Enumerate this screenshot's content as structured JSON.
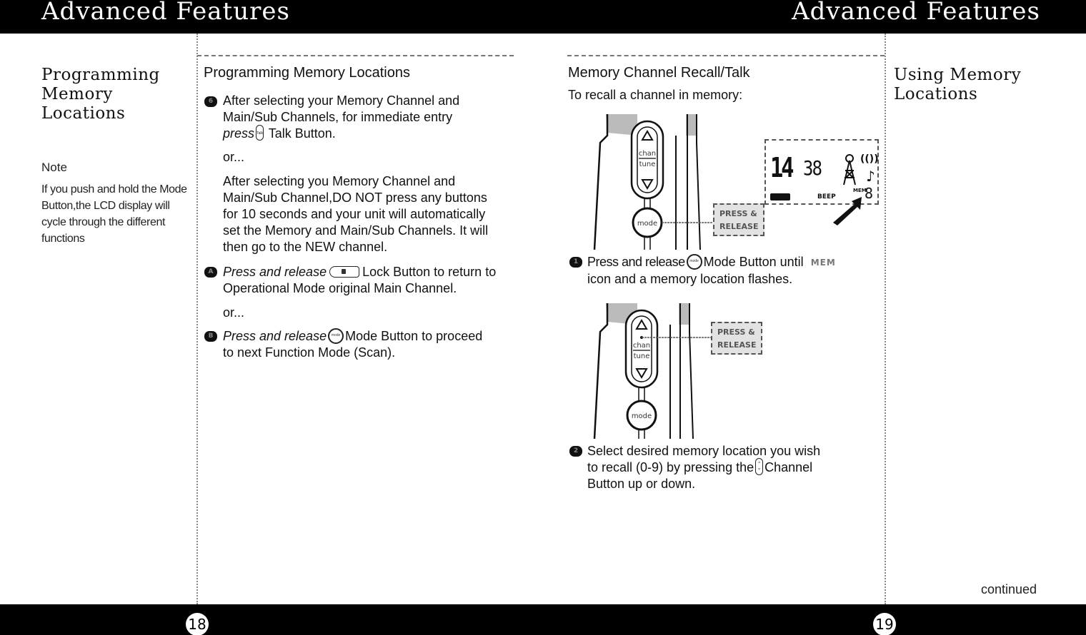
{
  "header": {
    "left_title": "Advanced Features",
    "right_title": "Advanced Features"
  },
  "left_page": {
    "side_title": "Programming Memory Locations",
    "note_label": "Note",
    "note_text": "If you push and hold the Mode Button,the LCD display will cycle through the different functions",
    "section_title": "Programming Memory Locations",
    "steps": [
      {
        "bullet": "6",
        "lines": [
          "After selecting your Memory Channel and",
          "Main/Sub Channels, for immediate entry"
        ],
        "press_word": "press",
        "button_icon_label": "Talk",
        "after_button": "Talk Button."
      }
    ],
    "or_1": "or...",
    "auto_paragraph": [
      "After selecting you Memory Channel and",
      "Main/Sub  Channel,DO NOT press any buttons",
      "for 10 seconds and your unit will automatically",
      "set the Memory and Main/Sub Channels. It will",
      "then go to the NEW channel."
    ],
    "step_a": {
      "bullet": "A",
      "italic": "Press and release",
      "after_button": "Lock Button to return to",
      "line2": "Operational Mode original Main Channel."
    },
    "or_2": "or...",
    "step_b": {
      "bullet": "B",
      "italic": "Press and release",
      "button_icon_label": "mode",
      "after_button": "Mode Button to proceed",
      "line2": "to next Function Mode (Scan)."
    },
    "page_number": "18"
  },
  "right_page": {
    "side_title": "Using Memory Locations",
    "section_title": "Memory Channel Recall/Talk",
    "subtitle": "To recall a channel in memory:",
    "figure1": {
      "key_up": "chan",
      "key_down": "tune",
      "mode_key": "mode",
      "callout": [
        "PRESS &",
        "RELEASE"
      ],
      "lcd": {
        "main_channel": "14",
        "sub_channel": "38",
        "beep": "BEEP",
        "mem": "MEM",
        "mem_digit": "8"
      }
    },
    "step_1": {
      "bullet": "1",
      "before_button": "Press and release",
      "button_icon_label": "mode",
      "after_button": "Mode Button until",
      "mem_icon": "MEM",
      "line2": "icon and a memory location flashes."
    },
    "figure2": {
      "key_up": "chan",
      "key_down": "tune",
      "mode_key": "mode",
      "callout": [
        "PRESS &",
        "RELEASE"
      ]
    },
    "step_2": {
      "bullet": "2",
      "line1": "Select desired memory location you wish",
      "before_button": "to recall (0-9) by pressing the",
      "after_button": "Channel",
      "line3": "Button up or down."
    },
    "continued": "continued",
    "page_number": "19"
  },
  "colors": {
    "bar": "#000000",
    "text": "#111111",
    "callout_fill": "#e2e2e2",
    "divider": "#888888"
  }
}
